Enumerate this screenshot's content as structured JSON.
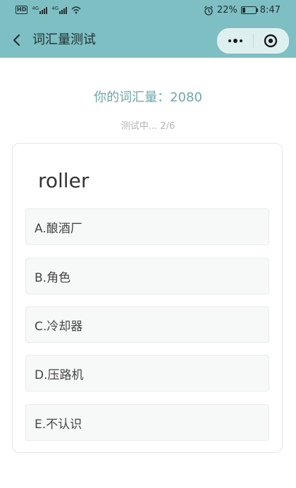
{
  "status": {
    "network_left": "4G",
    "network_right": "4G",
    "battery_percent": "22%",
    "battery_level": 0.22,
    "time": "8:47",
    "hd_badge": "HD"
  },
  "nav": {
    "title": "词汇量测试"
  },
  "quiz": {
    "score_text": "你的词汇量：2080",
    "progress_text": "测试中... 2/6",
    "word": "roller",
    "options": [
      {
        "label": "A.酿酒厂"
      },
      {
        "label": "B.角色"
      },
      {
        "label": "C.冷却器"
      },
      {
        "label": "D.压路机"
      },
      {
        "label": "E.不认识"
      }
    ]
  },
  "colors": {
    "header_bg": "#7ebfc3",
    "accent": "#6fa7a8"
  }
}
